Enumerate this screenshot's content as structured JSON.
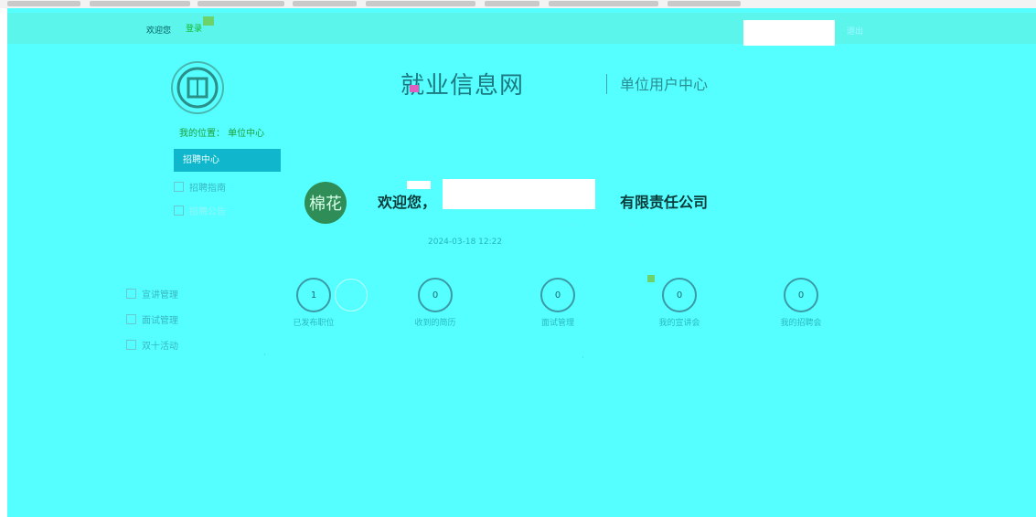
{
  "topbar": {
    "welcome": "欢迎您",
    "login_text": "登录",
    "link_text": "退出"
  },
  "header": {
    "brand": "就业信息网",
    "center_title": "单位用户中心"
  },
  "breadcrumb": {
    "text": "我的位置： 单位中心"
  },
  "sidebar": {
    "active": "招聘中心",
    "items": [
      {
        "label": "招聘指南"
      },
      {
        "label": "招聘公告"
      },
      {
        "label": "宣讲管理"
      },
      {
        "label": "面试管理"
      },
      {
        "label": "双十活动"
      }
    ]
  },
  "profile": {
    "greeting": "欢迎您，",
    "company_suffix": "有限责任公司",
    "login_time": "2024-03-18 12:22",
    "avatar_text": "棉花"
  },
  "stats": [
    {
      "value": "1",
      "label": "已发布职位"
    },
    {
      "value": "0",
      "label": "收到的简历"
    },
    {
      "value": "0",
      "label": "面试管理"
    },
    {
      "value": "0",
      "label": "我的宣讲会"
    },
    {
      "value": "0",
      "label": "我的招聘会"
    }
  ],
  "colors": {
    "page_bg": "#55ffff",
    "accent": "#10b7cc",
    "masking": "#ffffff"
  }
}
